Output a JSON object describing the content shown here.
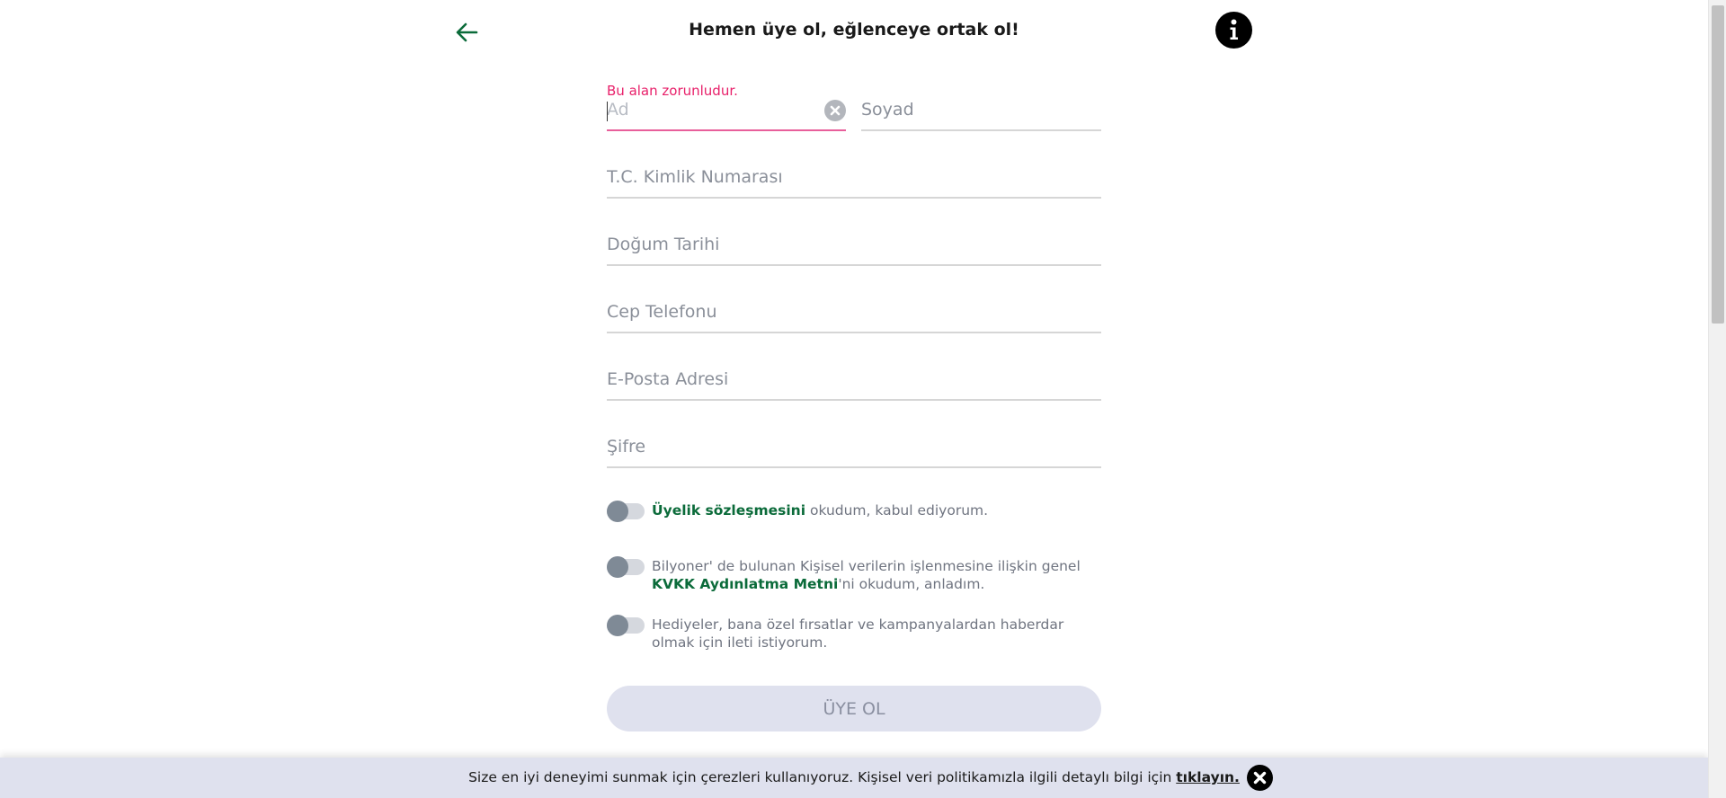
{
  "header": {
    "title": "Hemen üye ol, eğlenceye ortak ol!",
    "back_icon": "arrow-left-icon",
    "info_icon": "info-icon",
    "accent_color": "#0b6b3a"
  },
  "form": {
    "error_message": "Bu alan zorunludur.",
    "first_name": {
      "placeholder": "Ad",
      "value": ""
    },
    "last_name": {
      "placeholder": "Soyad",
      "value": ""
    },
    "tc_id": {
      "placeholder": "T.C. Kimlik Numarası",
      "value": ""
    },
    "birth_date": {
      "placeholder": "Doğum Tarihi",
      "value": ""
    },
    "phone": {
      "placeholder": "Cep Telefonu",
      "value": ""
    },
    "email": {
      "placeholder": "E-Posta Adresi",
      "value": ""
    },
    "password": {
      "placeholder": "Şifre",
      "value": ""
    },
    "consents": {
      "membership": {
        "link": "Üyelik sözleşmesini",
        "text": " okudum, kabul ediyorum.",
        "checked": false
      },
      "kvkk": {
        "text_before": "Bilyoner' de bulunan Kişisel verilerin işlenmesine ilişkin genel ",
        "link": "KVKK Aydınlatma Metni",
        "text_after": "'ni okudum, anladım.",
        "checked": false
      },
      "marketing": {
        "text": "Hediyeler, bana özel fırsatlar ve kampanyalardan haberdar olmak için ileti istiyorum.",
        "checked": false
      }
    },
    "submit_label": "ÜYE OL"
  },
  "cookie_bar": {
    "text": "Size en iyi deneyimi sunmak için çerezleri kullanıyoruz. Kişisel veri politikamızla ilgili detaylı bilgi için ",
    "link": "tıklayın.",
    "close_icon": "close-icon"
  }
}
